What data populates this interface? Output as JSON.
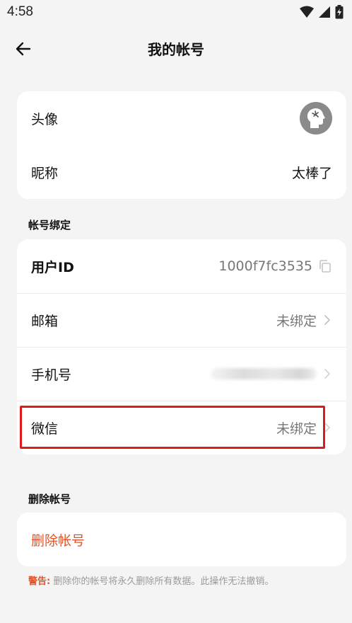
{
  "status_bar": {
    "time": "4:58"
  },
  "header": {
    "title": "我的帐号"
  },
  "profile": {
    "avatar_label": "头像",
    "nickname_label": "昵称",
    "nickname_value": "太棒了"
  },
  "account_binding": {
    "section_title": "帐号绑定",
    "user_id_label": "用户ID",
    "user_id_value": "1000f7fc3535",
    "email_label": "邮箱",
    "email_value": "未绑定",
    "phone_label": "手机号",
    "wechat_label": "微信",
    "wechat_value": "未绑定"
  },
  "delete_account": {
    "section_title": "删除帐号",
    "button_label": "删除帐号",
    "warning_prefix": "警告:",
    "warning_text": "删除你的帐号将永久删除所有数据。此操作无法撤销。"
  },
  "colors": {
    "background": "#f4f4f4",
    "card": "#ffffff",
    "danger": "#e0542a",
    "highlight": "#e0191b"
  }
}
